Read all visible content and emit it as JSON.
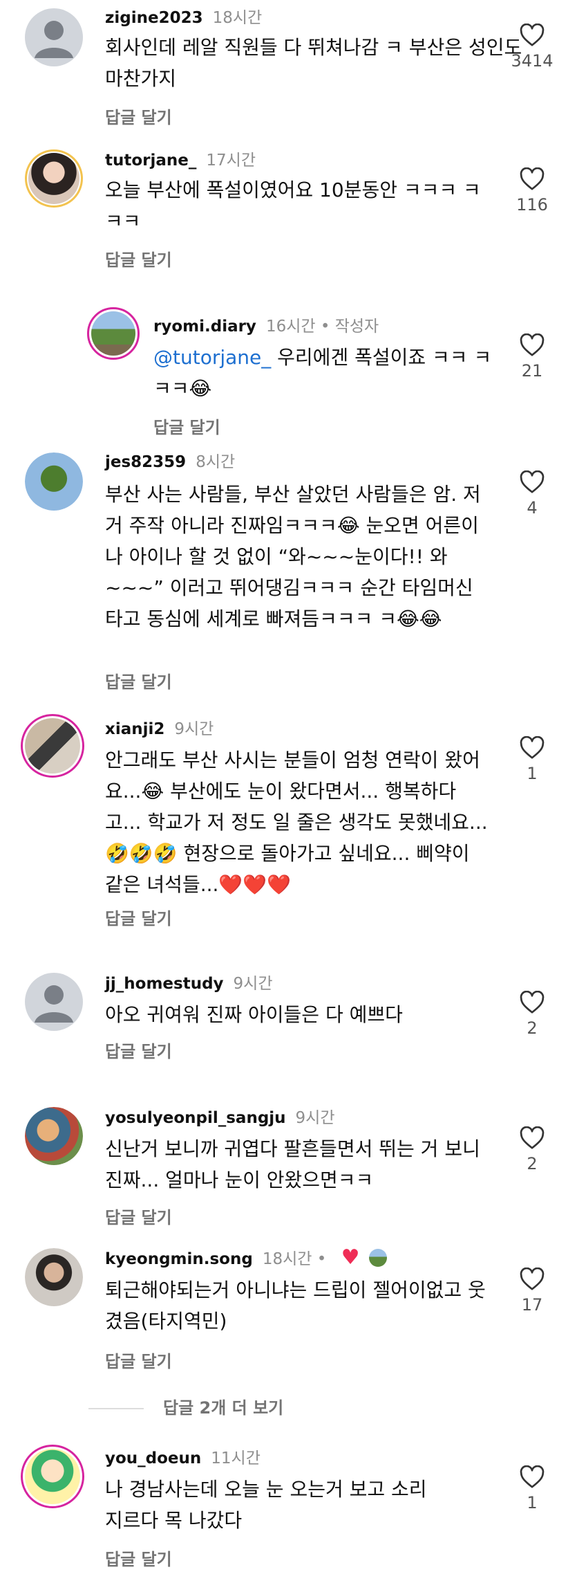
{
  "comments": [
    {
      "user": "zigine2023",
      "time": "18시간",
      "text": "회사인데 레알 직원들 다 뛰쳐나감 ㅋ 부산은 성인도 마찬가지",
      "reply": "답글 달기",
      "likes": "3414",
      "avatar": "default-avatar"
    },
    {
      "user": "tutorjane_",
      "time": "17시간",
      "text": "오늘 부산에 폭설이였어요 10분동안 ㅋㅋㅋ ㅋㅋㅋ",
      "reply": "답글 달기",
      "likes": "116",
      "avatar": "photo-avatar"
    },
    {
      "user": "ryomi.diary",
      "time": "16시간",
      "author": "• 작성자",
      "mention": "@tutorjane_",
      "text": " 우리에겐 폭설이죠 ㅋㅋ ㅋㅋㅋ😂",
      "reply": "답글 달기",
      "likes": "21",
      "avatar": "photo-avatar"
    },
    {
      "user": "jes82359",
      "time": "8시간",
      "text": "부산 사는 사람들, 부산 살았던 사람들은 암. 저거 주작 아니라 진짜임ㅋㅋㅋ😂 눈오면 어른이나 아이나 할 것 없이 “와~~~눈이다!! 와~~~” 이러고 뛰어댕김ㅋㅋㅋ 순간 타임머신 타고 동심에 세계로 빠져듬ㅋㅋㅋ ㅋ😂😂",
      "reply": "답글 달기",
      "likes": "4",
      "avatar": "photo-avatar"
    },
    {
      "user": "xianji2",
      "time": "9시간",
      "text": "안그래도 부산 사시는 분들이 엄청 연락이 왔어요...😂 부산에도 눈이 왔다면서... 행복하다고... 학교가 저 정도 일 줄은 생각도 못했네요...🤣🤣🤣 현장으로 돌아가고 싶네요... 삐약이 같은 녀석들...❤️❤️❤️",
      "reply": "답글 달기",
      "likes": "1",
      "avatar": "photo-avatar"
    },
    {
      "user": "jj_homestudy",
      "time": "9시간",
      "text": "아오 귀여워 진짜 아이들은 다 예쁘다",
      "reply": "답글 달기",
      "likes": "2",
      "avatar": "default-avatar"
    },
    {
      "user": "yosulyeonpil_sangju",
      "time": "9시간",
      "text": "신난거 보니까 귀엽다 팔흔들면서 뛰는 거 보니 진짜... 얼마나 눈이 안왔으면ㅋㅋ",
      "reply": "답글 달기",
      "likes": "2",
      "avatar": "photo-avatar"
    },
    {
      "user": "kyeongmin.song",
      "time": "18시간 •",
      "text": "퇴근해야되는거 아니냐는 드립이 젤어이없고 웃겼음(타지역민)",
      "reply": "답글 달기",
      "likes": "17",
      "avatar": "photo-avatar"
    },
    {
      "user": "you_doeun",
      "time": "11시간",
      "text": "나 경남사는데 오늘 눈 오는거 보고 소리지르다 목 나갔다",
      "reply": "답글 달기",
      "likes": "1",
      "avatar": "photo-avatar"
    }
  ],
  "view_more": "답글 2개 더 보기",
  "icons": {
    "like": "heart-outline-icon",
    "liked": "red-heart-icon"
  },
  "colors": {
    "mention": "#1d6fd0",
    "secondary": "#8e8e8e",
    "ring": "#e1306c",
    "heart": "#ef2d56"
  }
}
